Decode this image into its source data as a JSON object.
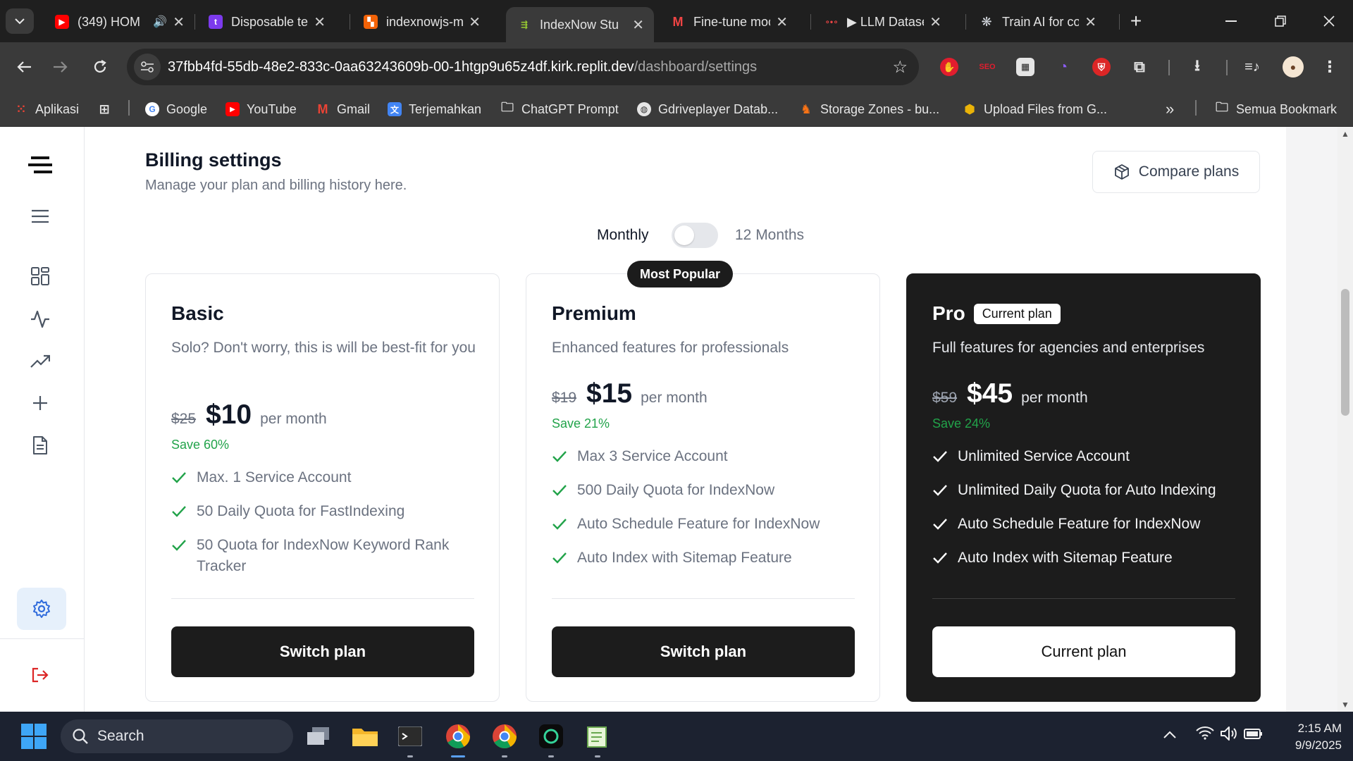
{
  "browser": {
    "tabs": [
      {
        "title": "(349) HOM",
        "icon": "youtube-icon",
        "color": "#ff0000",
        "audio": true
      },
      {
        "title": "Disposable te",
        "icon": "t-icon",
        "color": "#7c3aed"
      },
      {
        "title": "indexnowjs-m",
        "icon": "replit-icon",
        "color": "#f26207"
      },
      {
        "title": "IndexNow Stu",
        "icon": "indexnow-icon",
        "color": "#9acd32",
        "active": true
      },
      {
        "title": "Fine-tune moc",
        "icon": "m-icon",
        "color": "#ef4444"
      },
      {
        "title": "▶ LLM Datase",
        "icon": "graph-icon",
        "color": "#ef4444"
      },
      {
        "title": "Train AI for co",
        "icon": "openai-icon",
        "color": "#d1d5db"
      }
    ],
    "url_host": "37fbb4fd-55db-48e2-833c-0aa63243609b-00-1htgp9u65z4df.kirk.replit.dev",
    "url_path": "/dashboard/settings",
    "bookmarks": [
      {
        "label": "Aplikasi",
        "icon": "apps-grid-icon"
      },
      {
        "label": "",
        "icon": "tab-groups-icon"
      },
      {
        "label": "Google",
        "icon": "google-icon"
      },
      {
        "label": "YouTube",
        "icon": "youtube-icon"
      },
      {
        "label": "Gmail",
        "icon": "gmail-icon"
      },
      {
        "label": "Terjemahkan",
        "icon": "translate-icon"
      },
      {
        "label": "ChatGPT Prompt",
        "icon": "folder-icon"
      },
      {
        "label": "Gdriveplayer Datab...",
        "icon": "globe-icon"
      },
      {
        "label": "Storage Zones - bu...",
        "icon": "bunny-icon"
      },
      {
        "label": "Upload Files from G...",
        "icon": "cube-icon"
      }
    ],
    "bookmarks_more": "»",
    "all_bookmarks": "Semua Bookmark"
  },
  "page": {
    "title": "Billing settings",
    "subtitle": "Manage your plan and billing history here.",
    "compare_label": "Compare plans",
    "toggle": {
      "monthly": "Monthly",
      "annual": "12 Months",
      "annual_on": false
    },
    "popular_badge": "Most Popular",
    "plans": [
      {
        "name": "Basic",
        "description": "Solo? Don't worry, this is will be best-fit for you",
        "old_price": "$25",
        "price": "$10",
        "period": "per month",
        "save": "Save 60%",
        "features": [
          "Max. 1 Service Account",
          "50 Daily Quota for FastIndexing",
          "50 Quota for IndexNow Keyword Rank Tracker"
        ],
        "cta": "Switch plan"
      },
      {
        "name": "Premium",
        "description": "Enhanced features for professionals",
        "old_price": "$19",
        "price": "$15",
        "period": "per month",
        "save": "Save 21%",
        "features": [
          "Max 3 Service Account",
          "500 Daily Quota for IndexNow",
          "Auto Schedule Feature for IndexNow",
          "Auto Index with Sitemap Feature"
        ],
        "cta": "Switch plan"
      },
      {
        "name": "Pro",
        "badge": "Current plan",
        "description": "Full features for agencies and enterprises",
        "old_price": "$59",
        "price": "$45",
        "period": "per month",
        "save": "Save 24%",
        "features": [
          "Unlimited Service Account",
          "Unlimited Daily Quota for Auto Indexing",
          "Auto Schedule Feature for IndexNow",
          "Auto Index with Sitemap Feature"
        ],
        "cta": "Current plan"
      }
    ]
  },
  "sidebar": {
    "icons": [
      "logo-icon",
      "menu-icon",
      "dashboard-icon",
      "activity-icon",
      "trending-icon",
      "plus-icon",
      "document-icon",
      "settings-icon",
      "logout-icon"
    ],
    "active": "settings-icon",
    "accent": "#2f6bdc"
  },
  "taskbar": {
    "search_placeholder": "Search",
    "time": "2:15 AM",
    "date": "9/9/2025"
  },
  "colors": {
    "save_green": "#22a34a",
    "dark_card": "#1c1c1c"
  }
}
